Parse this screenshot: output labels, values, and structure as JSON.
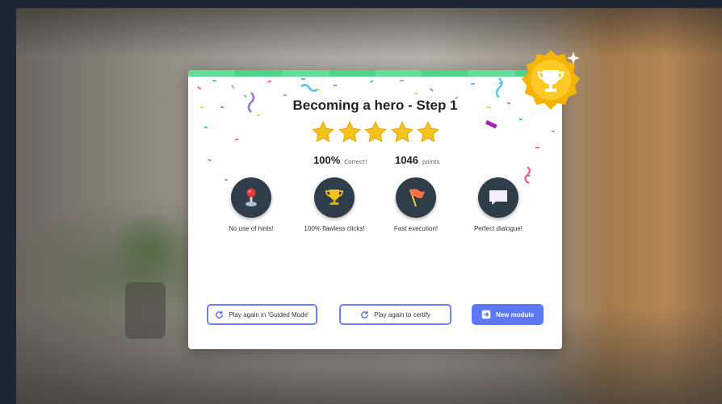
{
  "result": {
    "title": "Becoming a hero - Step 1",
    "stars_earned": 5,
    "stars_total": 5,
    "correct_value": "100%",
    "correct_label": "Correct!",
    "points_value": "1046",
    "points_label": "points"
  },
  "achievements": [
    {
      "icon": "joystick-icon",
      "label": "No use of hints!"
    },
    {
      "icon": "trophy-icon",
      "label": "100% flawless clicks!"
    },
    {
      "icon": "flag-icon",
      "label": "Fast execution!"
    },
    {
      "icon": "speech-bubble-icon",
      "label": "Perfect dialogue!"
    }
  ],
  "buttons": {
    "guided": "Play again in 'Guided Mode'",
    "certify": "Play again to certify",
    "new_module": "New module"
  },
  "colors": {
    "accent": "#5c78f5",
    "progress": "#4cd68a",
    "star": "#f6c21c",
    "badge_bg": "#2f3d4b",
    "trophy_badge": "#f5b400"
  }
}
